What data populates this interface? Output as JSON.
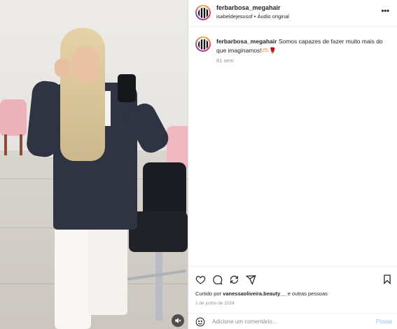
{
  "post": {
    "username": "ferbarbosa_megahair",
    "subtitle": "isabeldejesusof • Áudio original",
    "more_icon": "more-horizontal-icon"
  },
  "caption": {
    "username": "ferbarbosa_megahair",
    "text": "Somos capazes de fazer muito mais do que imaginamos!🫶🏻🌹",
    "time": "81 sem"
  },
  "actions": {
    "icons": [
      "heart-icon",
      "comment-icon",
      "share-icon",
      "send-icon",
      "bookmark-icon"
    ],
    "liked_prefix": "Curtido por",
    "liked_user": "vanessaoliveira.beauty__",
    "liked_suffix": "e outras pessoas",
    "date": "1 de junho de 2024"
  },
  "comment": {
    "placeholder": "Adicione um comentário...",
    "post_label": "Postar"
  },
  "colors": {
    "accent": "#0095f6",
    "post_disabled": "#8ec6f5",
    "text": "#262626",
    "muted": "#8e8e8e"
  }
}
